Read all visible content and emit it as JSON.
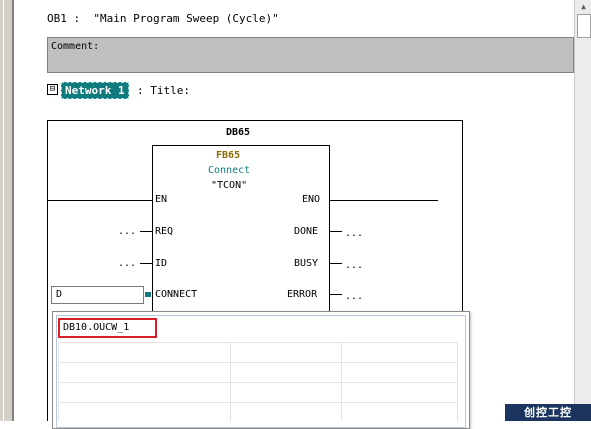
{
  "header": {
    "block_line": "OB1 :  \"Main Program Sweep (Cycle)\""
  },
  "comment": {
    "label": "Comment:"
  },
  "network": {
    "collapse_symbol": "⊟",
    "badge": "Network 1",
    "title_suffix": ": Title:"
  },
  "block": {
    "instance_db": "DB65",
    "fb_number": "FB65",
    "fb_comment": "Connect",
    "fb_symbol": "\"TCON\"",
    "inputs": [
      {
        "label": "EN",
        "value": ""
      },
      {
        "label": "REQ",
        "value": "..."
      },
      {
        "label": "ID",
        "value": "..."
      },
      {
        "label": "CONNECT",
        "value": "D"
      }
    ],
    "outputs": [
      {
        "label": "ENO",
        "value": ""
      },
      {
        "label": "DONE",
        "value": "..."
      },
      {
        "label": "BUSY",
        "value": "..."
      },
      {
        "label": "ERROR",
        "value": "..."
      }
    ]
  },
  "popup": {
    "highlighted_entry": "DB10.OUCW_1"
  },
  "watermark": {
    "text": "创控工控"
  },
  "colors": {
    "badge_bg": "#0f7b7d",
    "highlight_border": "#d81f26",
    "fb_number": "#8b6b00",
    "fb_comment": "#0f7b7d"
  }
}
